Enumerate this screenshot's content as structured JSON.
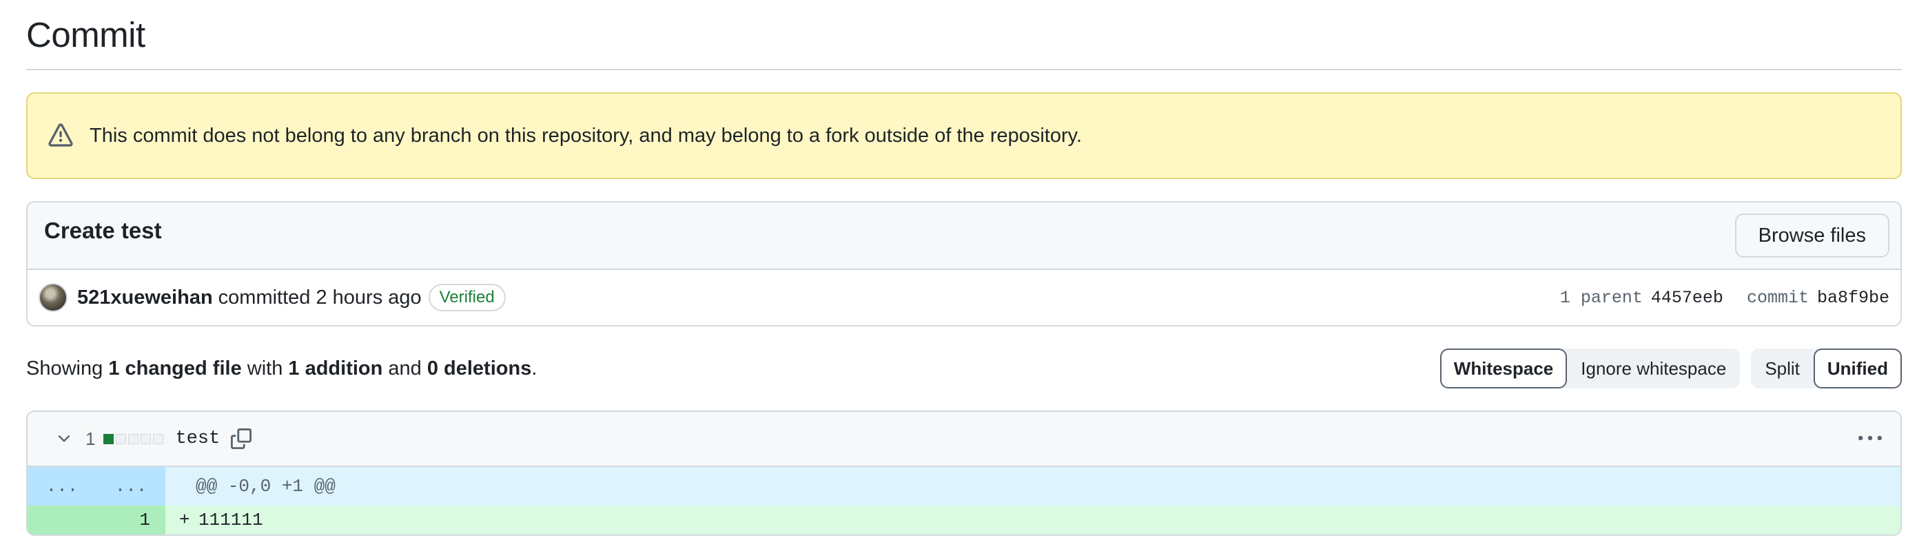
{
  "page": {
    "title": "Commit"
  },
  "flash": {
    "icon": "alert-icon",
    "message": "This commit does not belong to any branch on this repository, and may belong to a fork outside of the repository."
  },
  "commit": {
    "title": "Create test",
    "browse_label": "Browse files",
    "author": "521xueweihan",
    "committed_text": "committed 2 hours ago",
    "verified_label": "Verified",
    "parent_label": "1 parent",
    "parent_sha": "4457eeb",
    "commit_label": "commit",
    "commit_sha": "ba8f9be"
  },
  "summary": {
    "prefix": "Showing ",
    "changed": "1 changed file",
    "with": " with ",
    "additions": "1 addition",
    "and": " and ",
    "deletions": "0 deletions",
    "suffix": "."
  },
  "view_options": {
    "whitespace": "Whitespace",
    "ignore_whitespace": "Ignore whitespace",
    "split": "Split",
    "unified": "Unified",
    "active_whitespace": "Whitespace",
    "active_layout": "Unified"
  },
  "colors": {
    "addition": "#1a7f37",
    "flash_bg": "#fff8c5",
    "hunk_bg": "#ddf4ff",
    "add_bg": "#dafbe1"
  },
  "diff": {
    "change_count": "1",
    "filename": "test",
    "diffstat": [
      "add",
      "neutral",
      "neutral",
      "neutral",
      "neutral"
    ],
    "hunk": {
      "old_expand": "...",
      "new_expand": "...",
      "header": "@@ -0,0 +1 @@"
    },
    "lines": [
      {
        "old": "",
        "new": "1",
        "sign": "+",
        "text": "111111"
      }
    ]
  }
}
